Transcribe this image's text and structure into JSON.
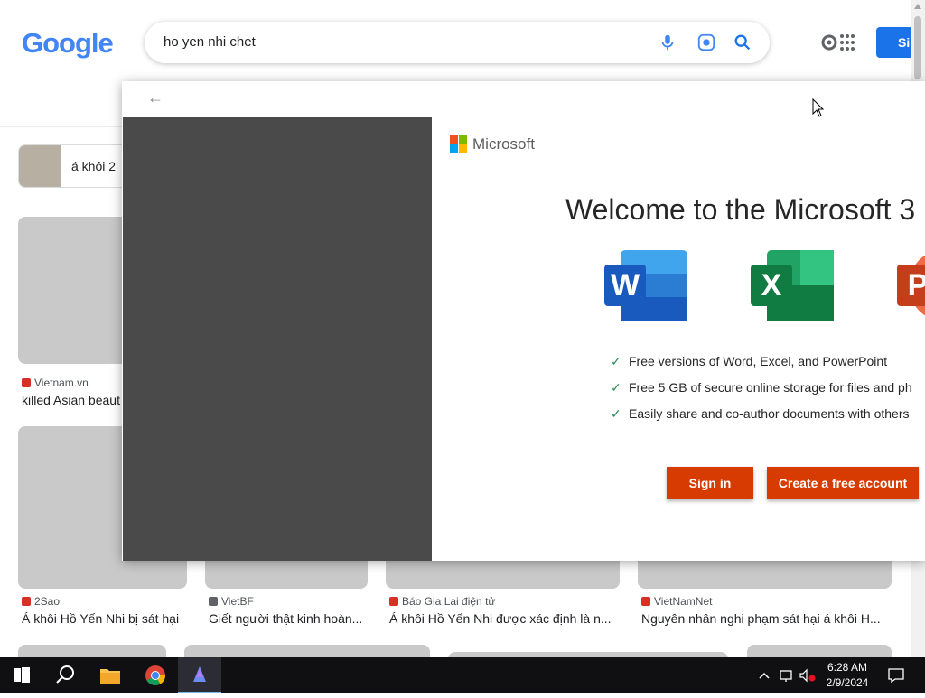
{
  "search": {
    "logo_text": "Google",
    "query": "ho yen nhi chet",
    "signin_label": "Si"
  },
  "suggestion": {
    "label": "á khôi 2"
  },
  "results": [
    {
      "source": "Vietnam.vn",
      "title": "killed Asian beaut",
      "fav_color": "#d93025"
    },
    {
      "source": "2Sao",
      "title": "Á khôi Hồ Yến Nhi bị sát hại",
      "fav_color": "#d93025"
    },
    {
      "source": "VietBF",
      "title": "Giết người thật kinh hoàn...",
      "fav_color": "#5f6368"
    },
    {
      "source": "Báo Gia Lai điện tử",
      "title": "Á khôi Hồ Yến Nhi được xác định là n...",
      "fav_color": "#d93025"
    },
    {
      "source": "VietNamNet",
      "title": "Nguyên nhân nghi phạm sát hại á khôi H...",
      "fav_color": "#d93025"
    }
  ],
  "dialog": {
    "brand": "Microsoft",
    "heading": "Welcome to the Microsoft 3",
    "features": [
      "Free versions of Word, Excel, and PowerPoint",
      "Free 5 GB of secure online storage for files and ph",
      "Easily share and co-author documents with others"
    ],
    "signin_button": "Sign in",
    "create_button": "Create a free account",
    "app_letters": {
      "word": "W",
      "excel": "X",
      "powerpoint": "P"
    },
    "colors": {
      "accent": "#d83b01",
      "word": "#185abd",
      "excel": "#107c41",
      "powerpoint": "#c43e1c"
    }
  },
  "taskbar": {
    "time": "6:28 AM",
    "date": "2/9/2024"
  }
}
